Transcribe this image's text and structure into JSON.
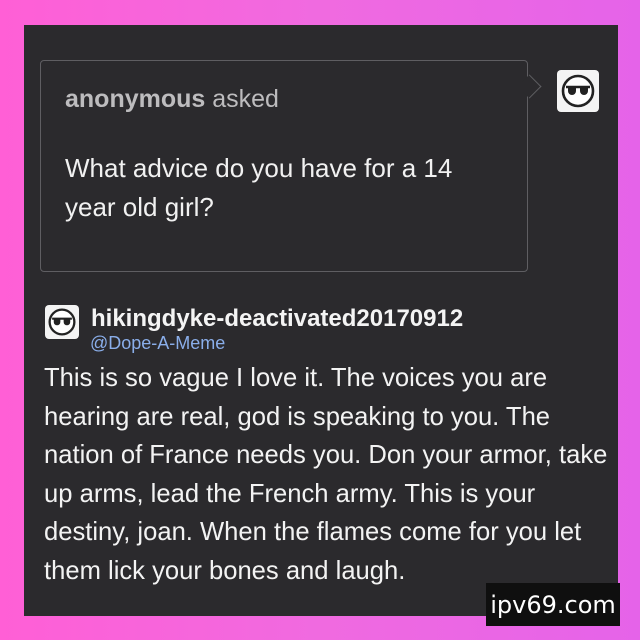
{
  "ask": {
    "asker_name": "anonymous",
    "asked_word": "asked",
    "question": "What advice do you have for a 14 year old girl?"
  },
  "answer": {
    "blog_name": "hikingdyke-deactivated20170912",
    "handle": "@Dope-A-Meme",
    "text": "This is so vague I love it. The voices you are hearing are real, god is speaking to you. The nation of France needs you. Don your armor, take up arms, lead the French army. This is your destiny, joan. When the flames come for you let them lick your bones and laugh."
  },
  "watermark": "ipv69.com",
  "icons": {
    "asker_avatar": "sunglasses-face-icon",
    "blog_avatar": "sunglasses-face-icon"
  },
  "colors": {
    "background_pink": "#ff5fd6",
    "card": "#2b2a2d",
    "handle_blue": "#8aaeea"
  }
}
